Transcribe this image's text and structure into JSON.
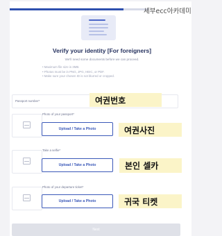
{
  "watermark": "세부ecc아카데미",
  "progress": {
    "fraction": 0.82
  },
  "header": {
    "icon": "document-icon",
    "title": "Verify your identity [For foreigners]",
    "intro": "We'll need some documents before we can proceed.",
    "requirements": [
      "Maximum file size is 3MB.",
      "Photos must be in PNG, JPG, HEIC, or PDF.",
      "Make sure your chosen ID is not blurred or cropped."
    ]
  },
  "passport_number": {
    "label": "Passport number",
    "value": "",
    "annotation": "여권번호"
  },
  "uploads": [
    {
      "label": "Photo of your passport",
      "button": "Upload / Take a Photo",
      "annotation": "여권사진"
    },
    {
      "label": "Take a selfie",
      "button": "Upload / Take a Photo",
      "annotation": "본인 셀카"
    },
    {
      "label": "Photo of your departure ticket",
      "button": "Upload / Take a Photo",
      "annotation": "귀국 티켓"
    }
  ],
  "next_button": "Next",
  "colors": {
    "accent": "#3a58b8",
    "annotation_bg": "#fbf4c8",
    "disabled": "#dfe1e8"
  },
  "required_marker": "*"
}
